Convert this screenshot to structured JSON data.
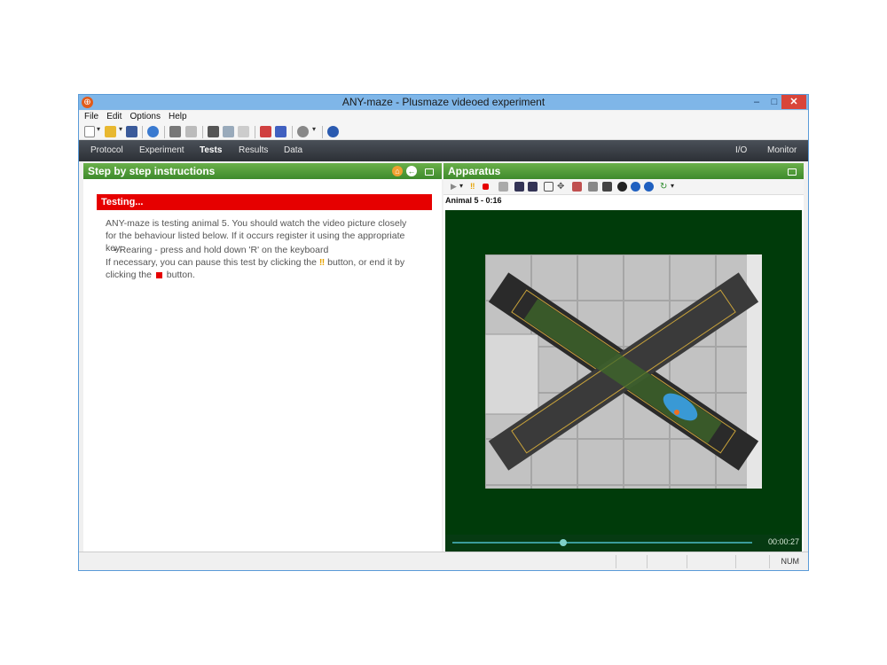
{
  "window": {
    "title": "ANY-maze - Plusmaze videoed experiment"
  },
  "menu": [
    "File",
    "Edit",
    "Options",
    "Help"
  ],
  "nav": {
    "left": [
      "Protocol",
      "Experiment",
      "Tests",
      "Results",
      "Data"
    ],
    "active": "Tests",
    "right": [
      "I/O",
      "Monitor"
    ]
  },
  "left_panel": {
    "title": "Step by step instructions",
    "testing_label": "Testing...",
    "paragraph1": "ANY-maze is testing animal 5. You should watch the video picture closely for the behaviour listed below. If it occurs register it using the appropriate key:",
    "bullet": "Rearing - press and hold down 'R' on the keyboard",
    "paragraph2_part1": "If necessary, you can pause this test by clicking the",
    "paragraph2_part2": "button, or end it by clicking the",
    "paragraph2_part3": "button."
  },
  "right_panel": {
    "title": "Apparatus",
    "animal_label": "Animal 5 - 0:16",
    "time": "00:00:27",
    "progress": 0.37
  },
  "status": {
    "num": "NUM"
  },
  "colors": {
    "accent_green": "#4a9a36",
    "testing_red": "#e60000",
    "video_bg": "#003b0a"
  }
}
